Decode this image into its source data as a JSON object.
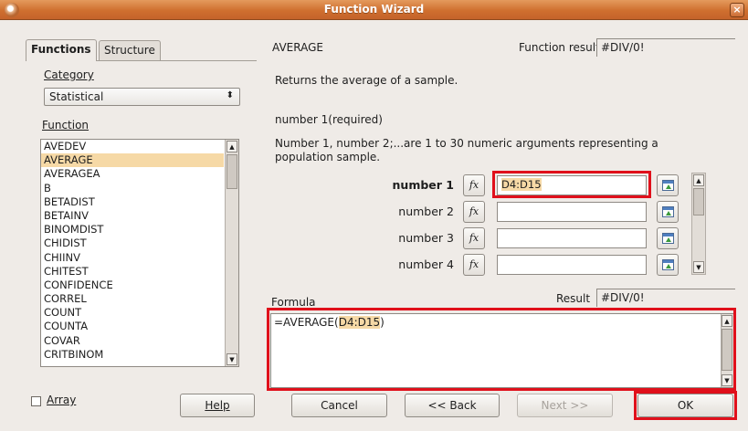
{
  "window": {
    "title": "Function Wizard",
    "close_glyph": "×"
  },
  "tabs": [
    {
      "label": "Functions",
      "active": true
    },
    {
      "label": "Structure",
      "active": false
    }
  ],
  "category": {
    "label": "Category",
    "selected": "Statistical",
    "arrow_glyph": "⬍"
  },
  "function_list": {
    "label": "Function",
    "items": [
      "AVEDEV",
      "AVERAGE",
      "AVERAGEA",
      "B",
      "BETADIST",
      "BETAINV",
      "BINOMDIST",
      "CHIDIST",
      "CHIINV",
      "CHITEST",
      "CONFIDENCE",
      "CORREL",
      "COUNT",
      "COUNTA",
      "COVAR",
      "CRITBINOM"
    ],
    "selected": "AVERAGE"
  },
  "function_info": {
    "name": "AVERAGE",
    "result_label": "Function result",
    "result_value": "#DIV/0!",
    "description": "Returns the average of a sample.",
    "param_heading": "number 1(required)",
    "param_description": "Number 1, number 2;...are 1 to 30 numeric arguments representing a population sample."
  },
  "arguments": [
    {
      "label": "number 1",
      "value": "D4:D15",
      "bold": true
    },
    {
      "label": "number 2",
      "value": ""
    },
    {
      "label": "number 3",
      "value": ""
    },
    {
      "label": "number 4",
      "value": ""
    }
  ],
  "fx_glyph": "fx",
  "formula": {
    "label": "Formula",
    "result_label": "Result",
    "result_value": "#DIV/0!",
    "prefix": "=AVERAGE(",
    "highlighted": "D4:D15",
    "suffix": ")"
  },
  "array_checkbox": {
    "label": "Array",
    "checked": false
  },
  "buttons": {
    "help": "Help",
    "cancel": "Cancel",
    "back": "<< Back",
    "next": "Next >>",
    "ok": "OK"
  },
  "colors": {
    "highlight": "#f6d9a6",
    "annotation_red": "#e0101b",
    "titlebar": "#cf6f2f"
  }
}
